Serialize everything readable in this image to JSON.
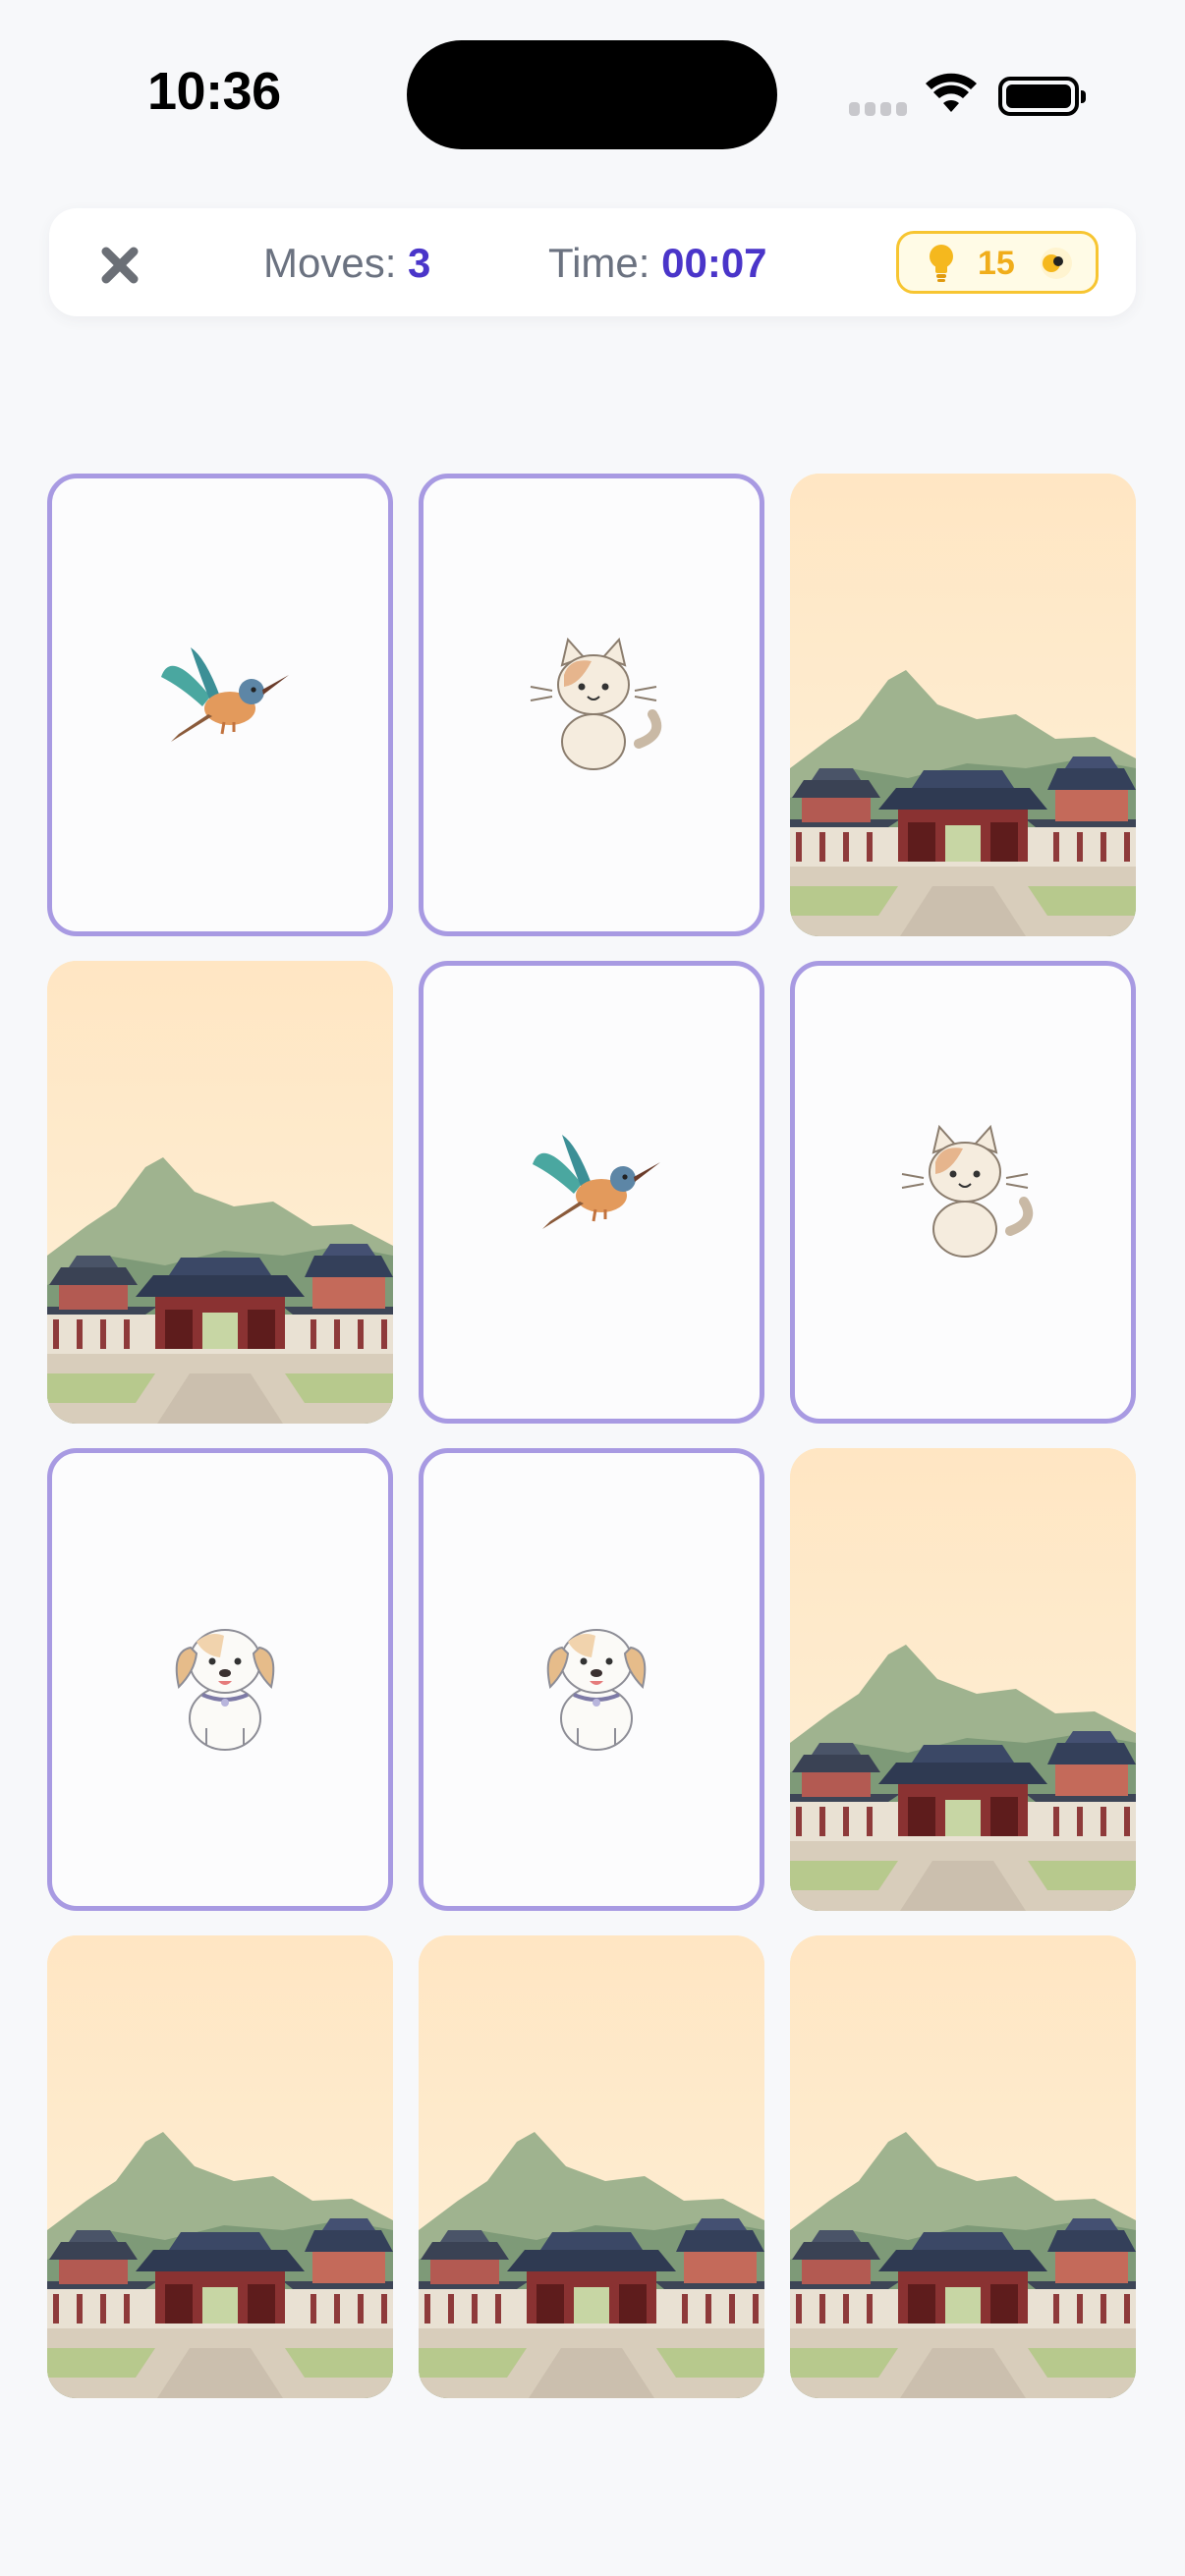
{
  "status_bar": {
    "time": "10:36"
  },
  "header": {
    "close_icon": "close-x-icon",
    "moves_label": "Moves:",
    "moves_value": "3",
    "time_label": "Time:",
    "time_value": "00:07",
    "hints_icon": "lightbulb-icon",
    "hints_count": "15",
    "hints_extra_icon": "coin-icon"
  },
  "colors": {
    "background": "#f7f8fa",
    "accent": "#4a35c9",
    "card_border": "#a89ae2",
    "hint_gold": "#f0ad1b"
  },
  "board": {
    "rows": 4,
    "columns": 3,
    "cards": [
      {
        "state": "face-up",
        "image": "kingfisher-bird"
      },
      {
        "state": "face-up",
        "image": "cat"
      },
      {
        "state": "face-down",
        "image": "palace-landscape-back"
      },
      {
        "state": "face-down",
        "image": "palace-landscape-back"
      },
      {
        "state": "face-up",
        "image": "kingfisher-bird"
      },
      {
        "state": "face-up",
        "image": "cat"
      },
      {
        "state": "face-up",
        "image": "puppy"
      },
      {
        "state": "face-up",
        "image": "puppy"
      },
      {
        "state": "face-down",
        "image": "palace-landscape-back"
      },
      {
        "state": "face-down",
        "image": "palace-landscape-back"
      },
      {
        "state": "face-down",
        "image": "palace-landscape-back"
      },
      {
        "state": "face-down",
        "image": "palace-landscape-back"
      }
    ]
  }
}
